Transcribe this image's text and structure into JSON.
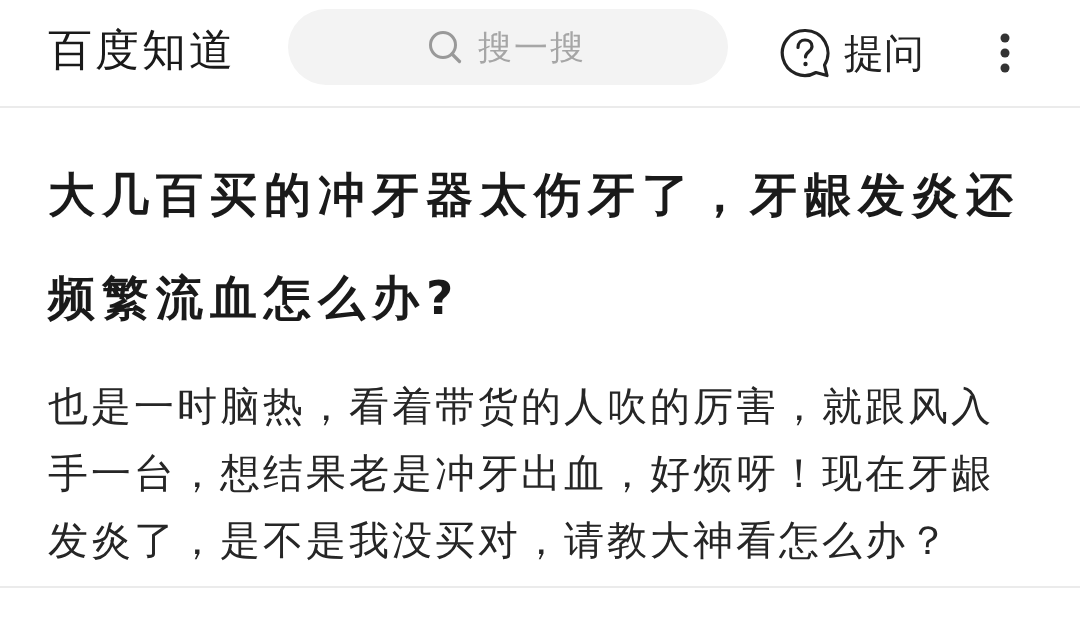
{
  "header": {
    "logo": "百度知道",
    "search": {
      "placeholder": "搜一搜"
    },
    "ask_button": {
      "label": "提问"
    }
  },
  "question": {
    "title": "大几百买的冲牙器太伤牙了，牙龈发炎还频繁流血怎么办?",
    "body": "也是一时脑热，看着带货的人吹的厉害，就跟风入手一台，想结果老是冲牙出血，好烦呀！现在牙龈发炎了，是不是我没买对，请教大神看怎么办？"
  }
}
